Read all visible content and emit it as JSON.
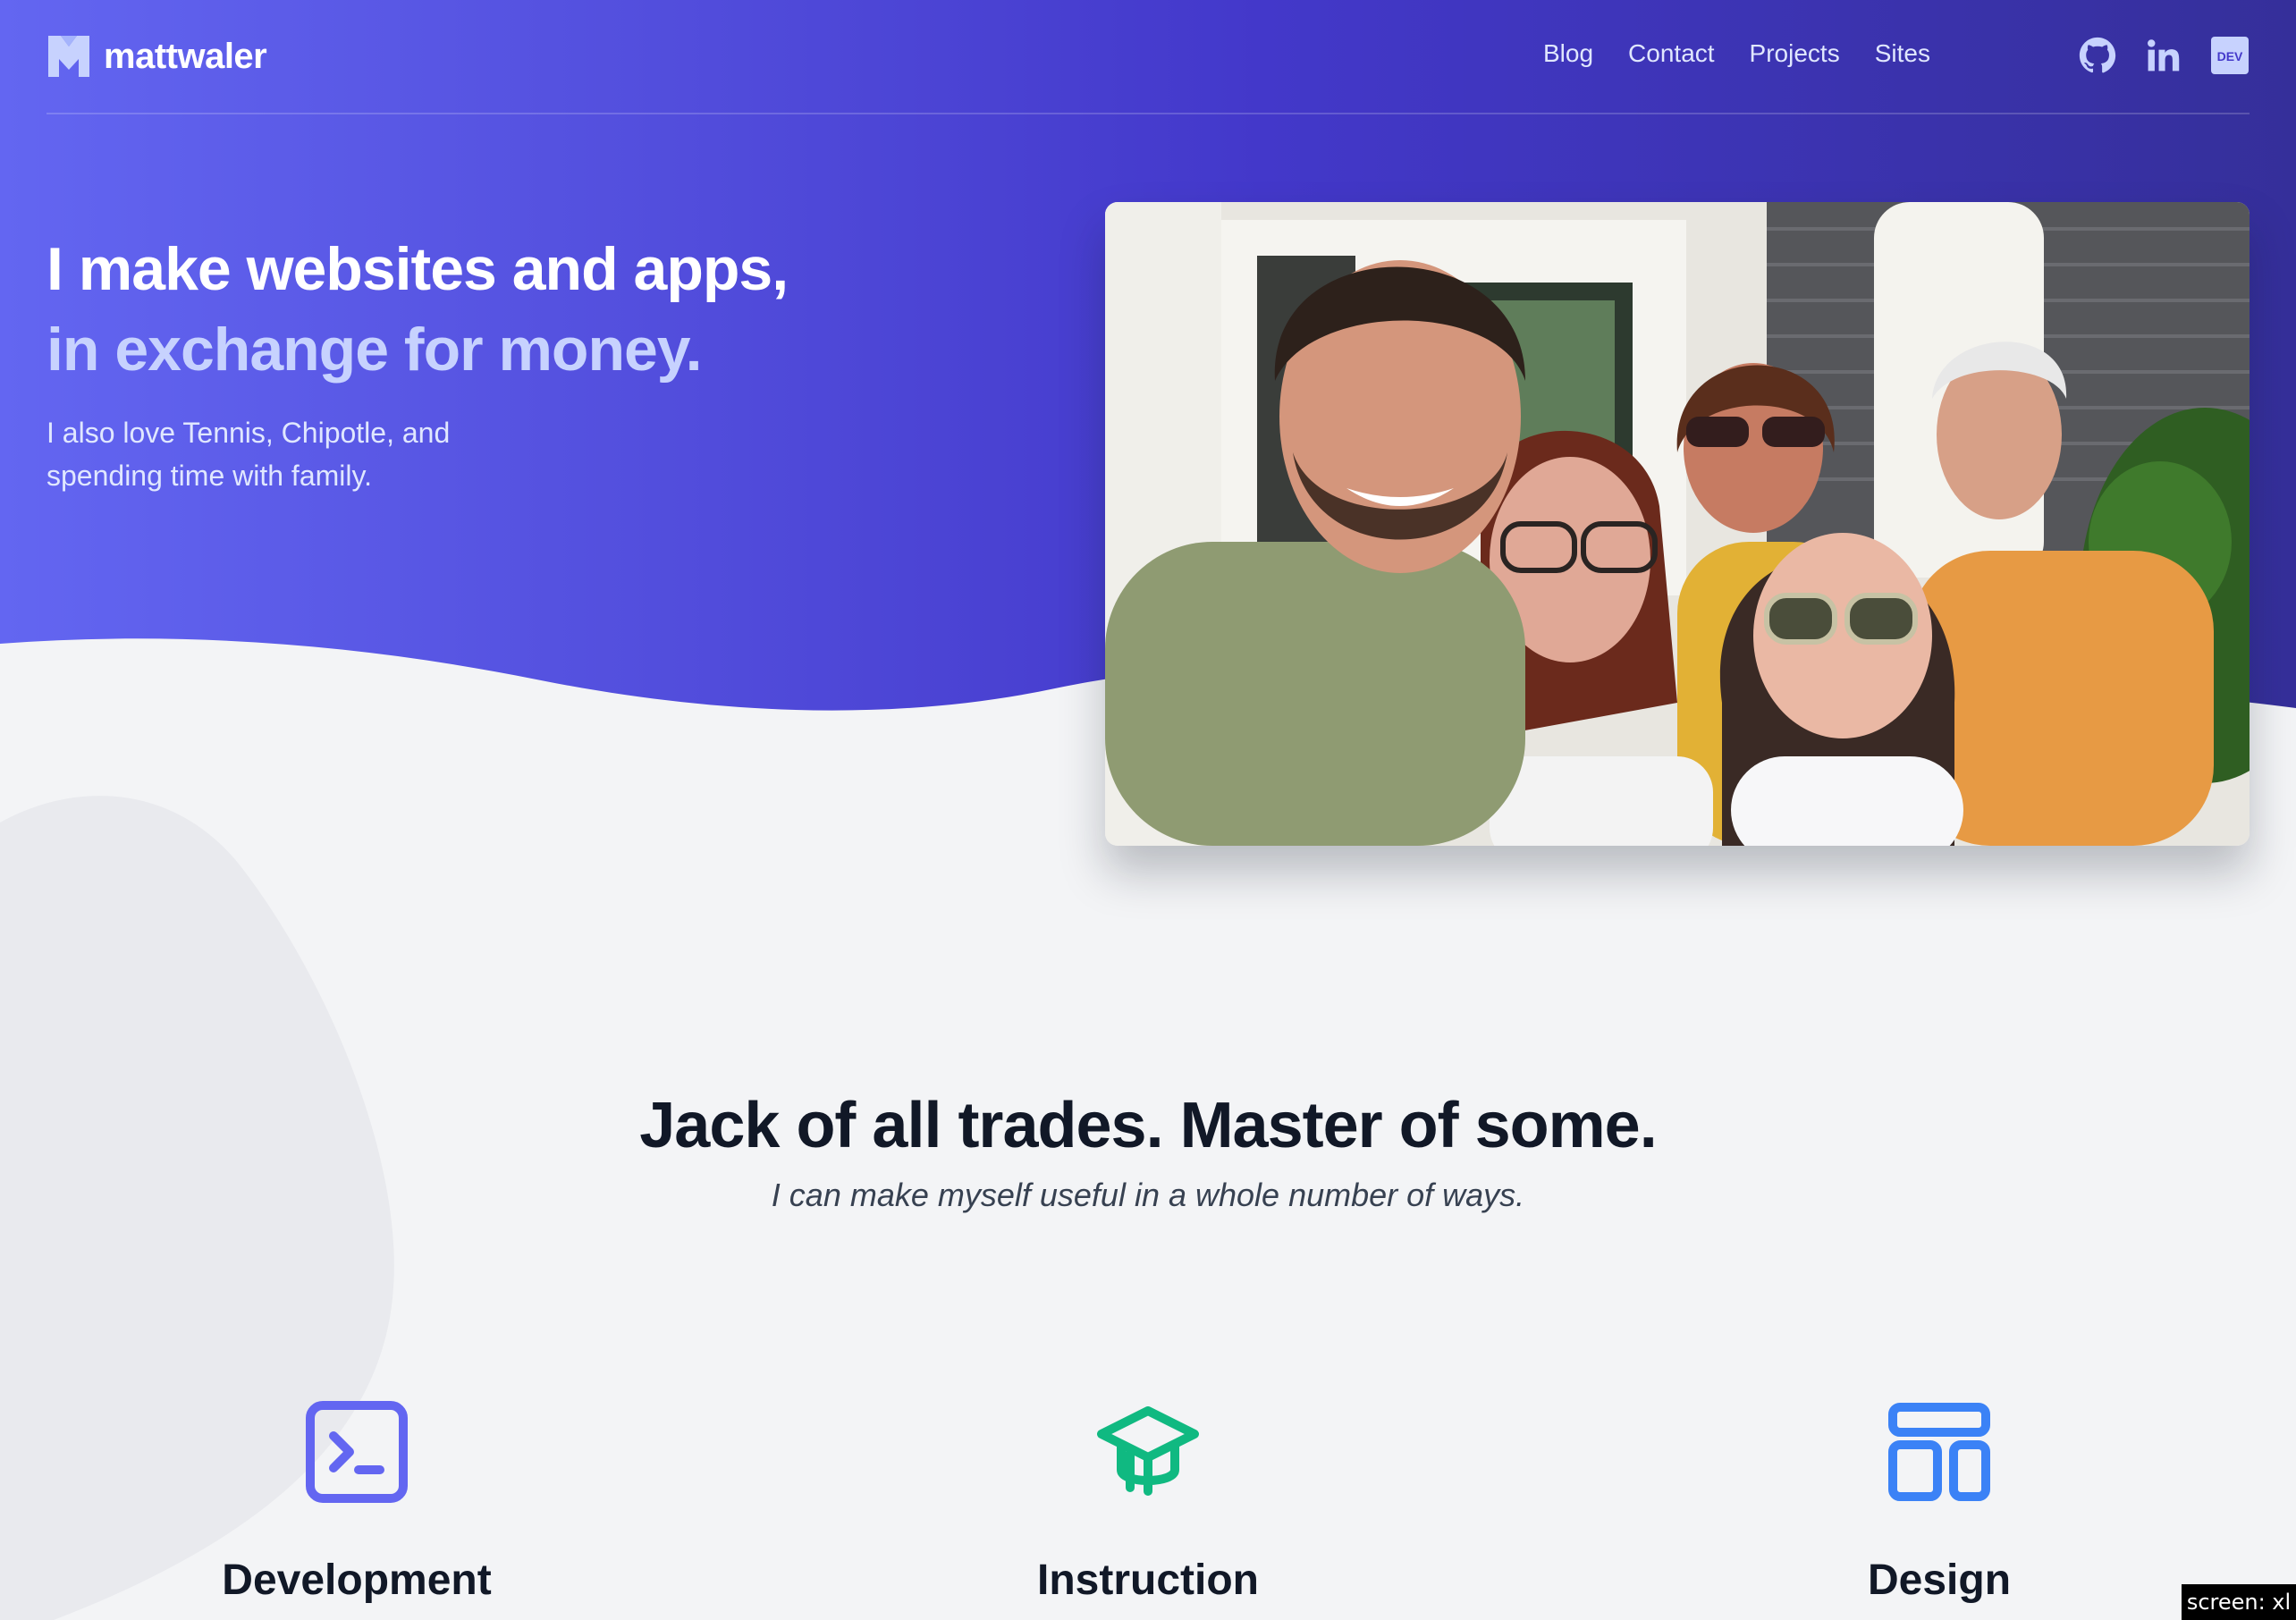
{
  "brand": {
    "name": "mattwaler"
  },
  "nav": {
    "items": [
      "Blog",
      "Contact",
      "Projects",
      "Sites"
    ]
  },
  "social": {
    "icons": [
      "github-icon",
      "linkedin-icon",
      "dev-icon"
    ],
    "dev_label": "DEV"
  },
  "hero": {
    "title_line1": "I make websites and apps,",
    "title_line2": "in exchange for money.",
    "subtitle": "I also love Tennis, Chipotle, and spending time with family."
  },
  "section": {
    "title": "Jack of all trades. Master of some.",
    "subtitle": "I can make myself useful in a whole number of ways."
  },
  "features": [
    {
      "title": "Development",
      "icon": "terminal-icon",
      "color": "#6366f1"
    },
    {
      "title": "Instruction",
      "icon": "graduation-cap-icon",
      "color": "#10b981"
    },
    {
      "title": "Design",
      "icon": "layout-icon",
      "color": "#3b82f6"
    }
  ],
  "badge": {
    "label": "screen: xl"
  },
  "colors": {
    "hero_gradient_start": "#6366f1",
    "hero_gradient_end": "#3730a3",
    "page_bg": "#f3f4f6"
  }
}
